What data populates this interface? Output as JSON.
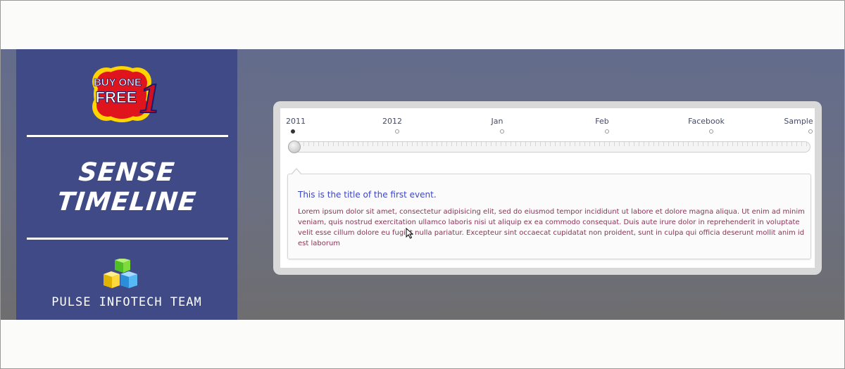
{
  "sidebar": {
    "badge": {
      "line1": "BUY ONE",
      "line2": "FREE",
      "digit": "1"
    },
    "title_line1": "SENSE",
    "title_line2": "TIMELINE",
    "team": "PULSE INFOTECH TEAM"
  },
  "timeline": {
    "markers": [
      {
        "label": "2011",
        "active": true
      },
      {
        "label": "2012",
        "active": false
      },
      {
        "label": "Jan",
        "active": false
      },
      {
        "label": "Feb",
        "active": false
      },
      {
        "label": "Facebook",
        "active": false
      },
      {
        "label": "Sample",
        "active": false
      }
    ],
    "event": {
      "title": "This is the title of the first event.",
      "body": "Lorem ipsum dolor sit amet, consectetur adipisicing elit, sed do eiusmod tempor incididunt ut labore et dolore magna aliqua. Ut enim ad minim veniam, quis nostrud exercitation ullamco laboris nisi ut aliquip ex ea commodo consequat. Duis aute irure dolor in reprehenderit in voluptate velit esse cillum dolore eu fugiat nulla pariatur. Excepteur sint occaecat cupidatat non proident, sunt in culpa qui officia deserunt mollit anim id est laborum"
    }
  },
  "colors": {
    "sidebar_bg": "#3f4a87",
    "event_title": "#3b46c8",
    "event_text": "#8a3355",
    "badge_red": "#e0141c",
    "badge_yellow": "#ffd400"
  }
}
